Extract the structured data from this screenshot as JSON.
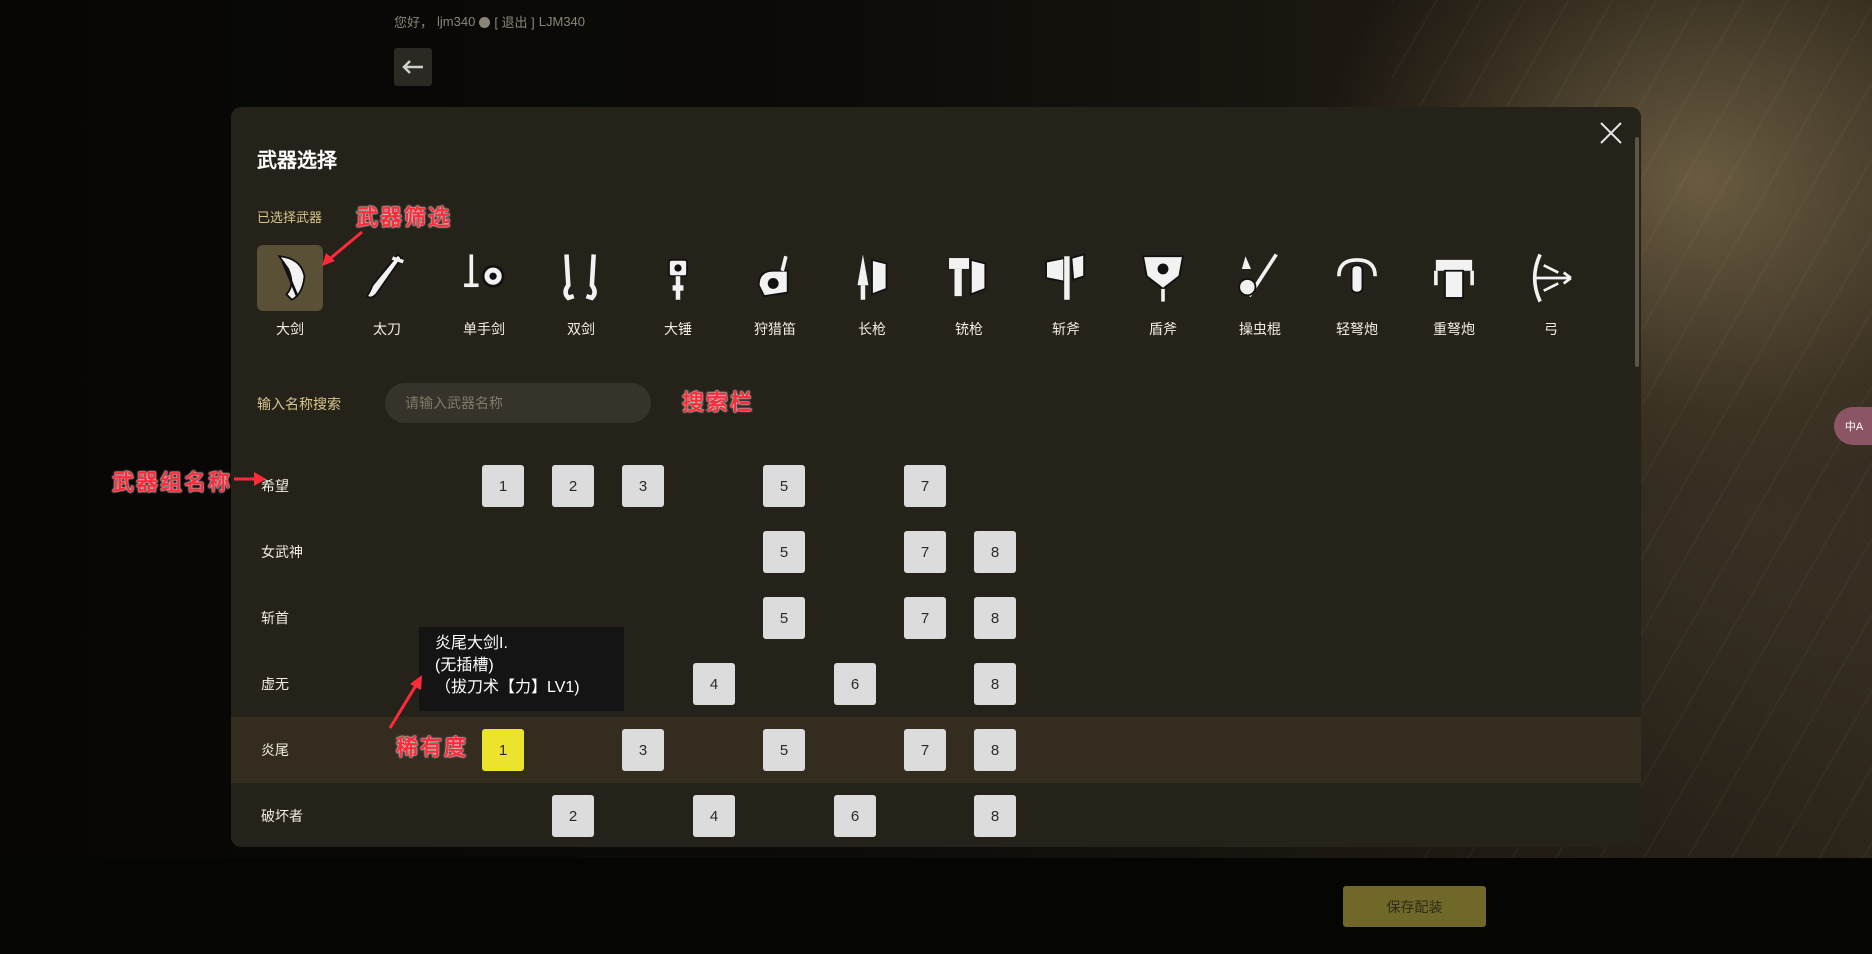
{
  "header": {
    "greeting": "您好，",
    "username": "ljm340",
    "logout": "[ 退出 ]",
    "account": "LJM340"
  },
  "modal": {
    "title": "武器选择",
    "selected_label": "已选择武器",
    "search_label": "输入名称搜索",
    "search_placeholder": "请输入武器名称"
  },
  "weapon_types": [
    {
      "label": "大剑",
      "icon": "great-sword-icon",
      "selected": true
    },
    {
      "label": "太刀",
      "icon": "long-sword-icon"
    },
    {
      "label": "单手剑",
      "icon": "sword-and-shield-icon"
    },
    {
      "label": "双剑",
      "icon": "dual-blades-icon"
    },
    {
      "label": "大锤",
      "icon": "hammer-icon"
    },
    {
      "label": "狩猎笛",
      "icon": "hunting-horn-icon"
    },
    {
      "label": "长枪",
      "icon": "lance-icon"
    },
    {
      "label": "铳枪",
      "icon": "gunlance-icon"
    },
    {
      "label": "斩斧",
      "icon": "switch-axe-icon"
    },
    {
      "label": "盾斧",
      "icon": "charge-blade-icon"
    },
    {
      "label": "操虫棍",
      "icon": "insect-glaive-icon"
    },
    {
      "label": "轻弩炮",
      "icon": "light-bowgun-icon"
    },
    {
      "label": "重弩炮",
      "icon": "heavy-bowgun-icon"
    },
    {
      "label": "弓",
      "icon": "bow-icon"
    }
  ],
  "weapon_groups": [
    {
      "name": "希望",
      "rarities": [
        "1",
        "2",
        "3",
        "5",
        "7"
      ]
    },
    {
      "name": "女武神",
      "rarities": [
        "5",
        "7",
        "8"
      ]
    },
    {
      "name": "斩首",
      "rarities": [
        "5",
        "7",
        "8"
      ]
    },
    {
      "name": "虚无",
      "rarities": [
        "4",
        "6",
        "8"
      ]
    },
    {
      "name": "炎尾",
      "rarities": [
        "1",
        "3",
        "5",
        "7",
        "8"
      ],
      "active": "1"
    },
    {
      "name": "破坏者",
      "rarities": [
        "2",
        "4",
        "6",
        "8"
      ]
    }
  ],
  "tooltip": {
    "line1": "炎尾大剑I.",
    "line2": "(无插槽)",
    "line3": "（拔刀术【力】LV1)"
  },
  "footer": {
    "save_label": "保存配装"
  },
  "float_button": {
    "label": "中A"
  },
  "annotations": {
    "weapon_filter": "武器筛选",
    "search_bar": "搜索栏",
    "group_name": "武器组名称",
    "rarity": "稀有度"
  },
  "colors": {
    "modal_bg": "#25221a",
    "selected_icon_bg": "#5a5036",
    "active_rarity": "#ece42c",
    "save_button": "#6f6828",
    "annotation": "#ff2a3a"
  }
}
